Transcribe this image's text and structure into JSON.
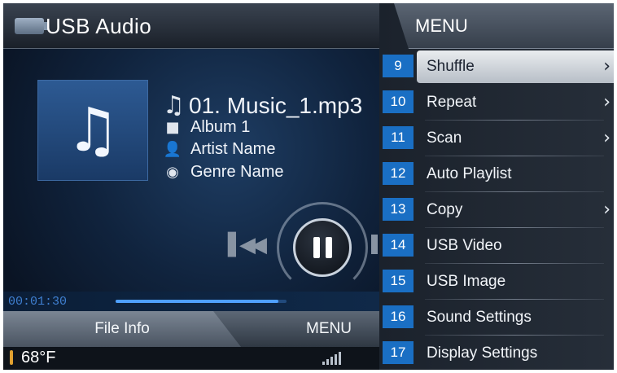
{
  "app": {
    "title": "USB Audio",
    "usb_icon": "usb-drive-icon"
  },
  "track": {
    "title": "01. Music_1.mp3",
    "album": "Album 1",
    "artist": "Artist Name",
    "genre": "Genre Name",
    "icons": {
      "title": "music-note-icon",
      "album": "folder-icon",
      "artist": "person-icon",
      "genre": "genre-disc-icon"
    }
  },
  "playback": {
    "elapsed": "00:01:30",
    "progress_fraction": 0.95,
    "state": "playing"
  },
  "tabs": {
    "file_info": "File Info",
    "menu": "MENU"
  },
  "status": {
    "temperature": "68°F"
  },
  "menu": {
    "title": "MENU",
    "items": [
      {
        "number": "9",
        "label": "Shuffle",
        "has_submenu": true,
        "selected": true
      },
      {
        "number": "10",
        "label": "Repeat",
        "has_submenu": true,
        "selected": false
      },
      {
        "number": "11",
        "label": "Scan",
        "has_submenu": true,
        "selected": false
      },
      {
        "number": "12",
        "label": "Auto Playlist",
        "has_submenu": false,
        "selected": false
      },
      {
        "number": "13",
        "label": "Copy",
        "has_submenu": true,
        "selected": false
      },
      {
        "number": "14",
        "label": "USB Video",
        "has_submenu": false,
        "selected": false
      },
      {
        "number": "15",
        "label": "USB Image",
        "has_submenu": false,
        "selected": false
      },
      {
        "number": "16",
        "label": "Sound Settings",
        "has_submenu": false,
        "selected": false
      },
      {
        "number": "17",
        "label": "Display Settings",
        "has_submenu": false,
        "selected": false
      }
    ]
  },
  "colors": {
    "callout_badge": "#1a6fc4",
    "progress": "#4fa0ff",
    "elapsed_text": "#3f7fd0"
  }
}
